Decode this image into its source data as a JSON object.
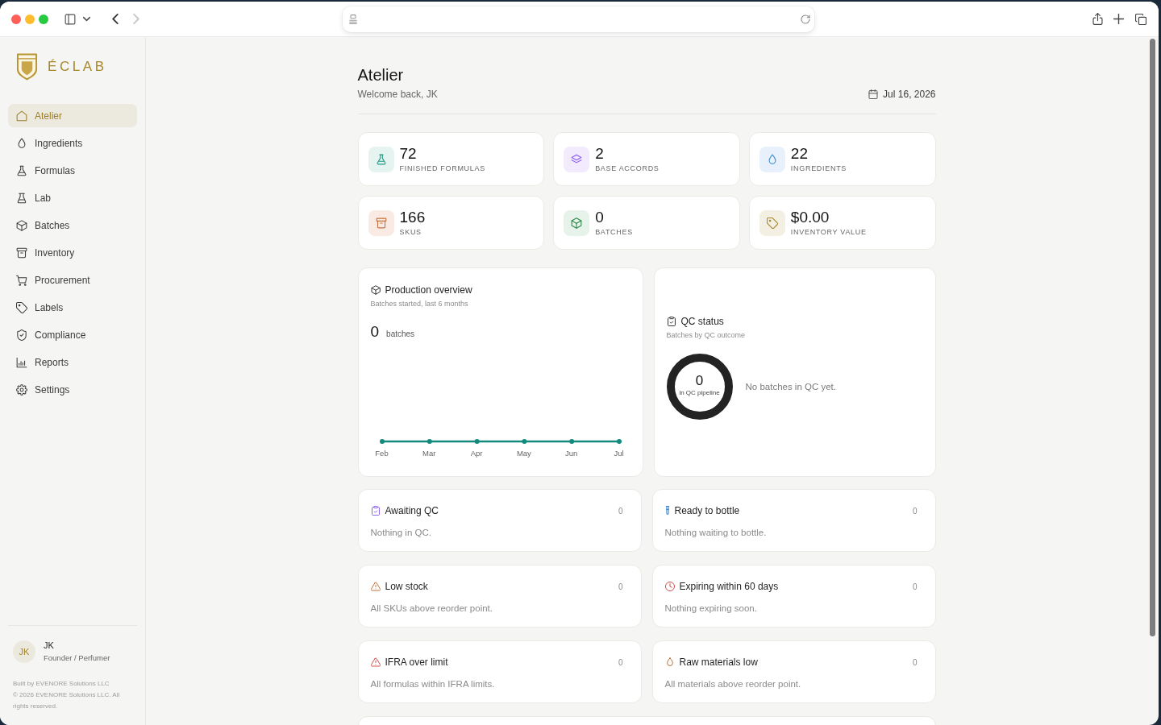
{
  "browser": {
    "nav_buttons": [
      {
        "kind": "back",
        "disabled": false
      },
      {
        "kind": "forward",
        "disabled": true
      }
    ]
  },
  "sidebar": {
    "brand": "ÉCLAB",
    "nav": [
      {
        "label": "Atelier",
        "selected": true
      },
      {
        "label": "Ingredients",
        "selected": false
      },
      {
        "label": "Formulas",
        "selected": false
      },
      {
        "label": "Lab",
        "selected": false
      },
      {
        "label": "Batches",
        "selected": false
      },
      {
        "label": "Inventory",
        "selected": false
      },
      {
        "label": "Procurement",
        "selected": false
      },
      {
        "label": "Labels",
        "selected": false
      },
      {
        "label": "Compliance",
        "selected": false
      },
      {
        "label": "Reports",
        "selected": false
      },
      {
        "label": "Settings",
        "selected": false
      }
    ],
    "user": {
      "initials": "JK",
      "name": "JK",
      "role": "Founder / Perfumer"
    },
    "footer": [
      "Built by EVENORE Solutions LLC",
      "© 2026 EVENORE Solutions LLC. All rights reserved."
    ]
  },
  "header": {
    "title": "Atelier",
    "subtitle": "Welcome back, JK",
    "date": "Jul 16, 2026"
  },
  "stats": [
    {
      "value": "72",
      "label": "FINISHED FORMULAS"
    },
    {
      "value": "2",
      "label": "BASE ACCORDS"
    },
    {
      "value": "22",
      "label": "INGREDIENTS"
    },
    {
      "value": "166",
      "label": "SKUS"
    },
    {
      "value": "0",
      "label": "BATCHES"
    },
    {
      "value": "$0.00",
      "label": "INVENTORY VALUE"
    }
  ],
  "production": {
    "title": "Production overview",
    "subtitle": "Batches started, last 6 months",
    "total": "0",
    "unit": "batches",
    "month_labels": [
      "Feb",
      "Mar",
      "Apr",
      "May",
      "Jun",
      "Jul"
    ]
  },
  "qc_status": {
    "title": "QC status",
    "subtitle": "Batches by QC outcome",
    "total": "0",
    "total_label": "in QC pipeline",
    "message": "No batches in QC yet."
  },
  "alerts": [
    {
      "title": "Awaiting QC",
      "count": "0",
      "message": "Nothing in QC."
    },
    {
      "title": "Ready to bottle",
      "count": "0",
      "message": "Nothing waiting to bottle."
    },
    {
      "title": "Low stock",
      "count": "0",
      "message": "All SKUs above reorder point."
    },
    {
      "title": "Expiring within 60 days",
      "count": "0",
      "message": "Nothing expiring soon."
    },
    {
      "title": "IFRA over limit",
      "count": "0",
      "message": "All formulas within IFRA limits."
    },
    {
      "title": "Raw materials low",
      "count": "0",
      "message": "All materials above reorder point."
    }
  ]
}
